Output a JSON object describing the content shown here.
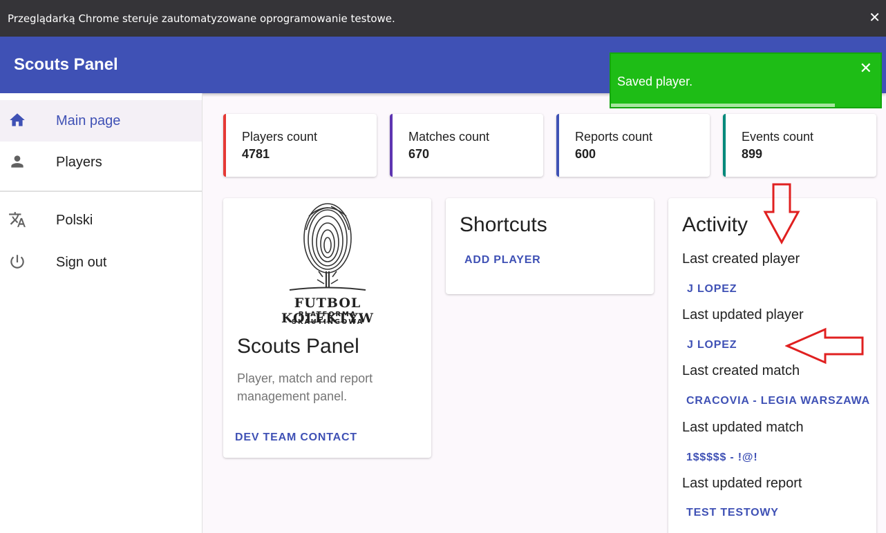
{
  "infobar": {
    "message": "Przeglądarką Chrome steruje zautomatyzowane oprogramowanie testowe.",
    "close": "✕"
  },
  "appbar": {
    "title": "Scouts Panel"
  },
  "sidebar": {
    "items": [
      {
        "label": "Main page",
        "icon": "home-icon"
      },
      {
        "label": "Players",
        "icon": "person-icon"
      },
      {
        "label": "Polski",
        "icon": "translate-icon"
      },
      {
        "label": "Sign out",
        "icon": "power-icon"
      }
    ]
  },
  "stats": [
    {
      "label": "Players count",
      "value": "4781",
      "color": "#e53935"
    },
    {
      "label": "Matches count",
      "value": "670",
      "color": "#5e35b1"
    },
    {
      "label": "Reports count",
      "value": "600",
      "color": "#3f51b5"
    },
    {
      "label": "Events count",
      "value": "899",
      "color": "#00897b"
    }
  ],
  "about": {
    "logo_brand": "FUTBOL KOLEKTYW",
    "logo_sub": "PLATFORMA SKAUTINGOWA",
    "title": "Scouts Panel",
    "description": "Player, match and report management panel.",
    "contact_link": "DEV TEAM CONTACT"
  },
  "shortcuts": {
    "title": "Shortcuts",
    "add_player": "ADD PLAYER"
  },
  "activity": {
    "title": "Activity",
    "last_created_player_label": "Last created player",
    "last_created_player": "J LOPEZ",
    "last_updated_player_label": "Last updated player",
    "last_updated_player": "J LOPEZ",
    "last_created_match_label": "Last created match",
    "last_created_match": "CRACOVIA - LEGIA WARSZAWA",
    "last_updated_match_label": "Last updated match",
    "last_updated_match": "1$$$$$ - !@!",
    "last_updated_report_label": "Last updated report",
    "last_updated_report": "TEST TESTOWY"
  },
  "toast": {
    "message": "Saved player.",
    "close": "✕",
    "progress": 0.83,
    "color": "#1ebd16"
  }
}
